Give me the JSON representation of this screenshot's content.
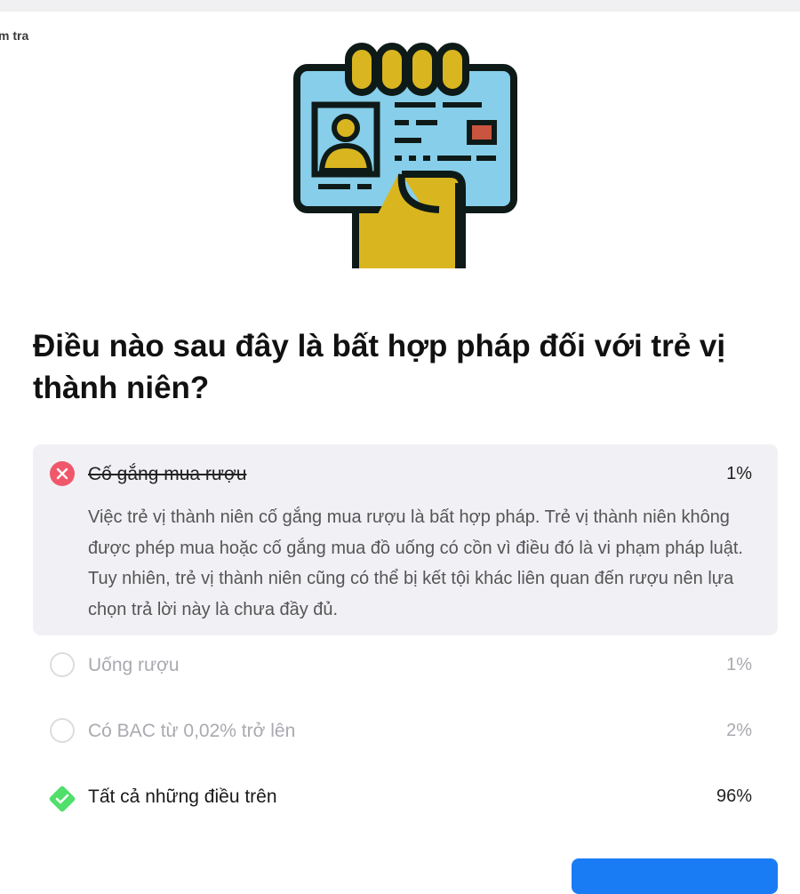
{
  "breadcrumb": "m tra",
  "question": "Điều nào sau đây là bất hợp pháp đối với trẻ vị thành niên?",
  "answers": [
    {
      "label": "Cố gắng mua rượu",
      "percent": "1%",
      "state": "wrong-selected",
      "explanation": "Việc trẻ vị thành niên cố gắng mua rượu là bất hợp pháp. Trẻ vị thành niên không được phép mua hoặc cố gắng mua đồ uống có cồn vì điều đó là vi phạm pháp luật. Tuy nhiên, trẻ vị thành niên cũng có thể bị kết tội khác liên quan đến rượu nên lựa chọn trả lời này là chưa đầy đủ."
    },
    {
      "label": "Uống rượu",
      "percent": "1%",
      "state": "unselected"
    },
    {
      "label": "Có BAC từ 0,02% trở lên",
      "percent": "2%",
      "state": "unselected"
    },
    {
      "label": "Tất cả những điều trên",
      "percent": "96%",
      "state": "correct"
    }
  ],
  "icons": {
    "illustration": "hand-holding-id-card",
    "wrong": "x-circle-icon",
    "correct": "check-diamond-icon"
  },
  "colors": {
    "wrong": "#f0576b",
    "correct": "#4fdf6a",
    "primary_button": "#1a7cf5",
    "card_blue": "#87ceea",
    "hand_yellow": "#d9b61f"
  }
}
